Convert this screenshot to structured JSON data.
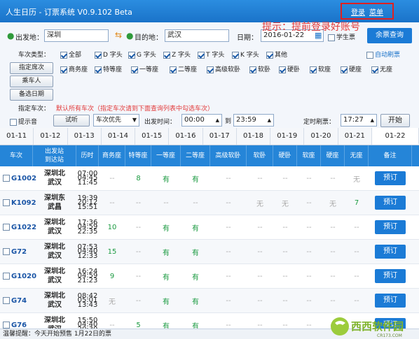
{
  "window": {
    "title": "人生日历 - 订票系统 V0.9.102 Beta",
    "login": "登录",
    "menu": "菜单"
  },
  "hint": "提示：提前登录好账号",
  "search": {
    "from_label": "出发地：",
    "from": "深圳",
    "to_label": "目的地：",
    "to": "武汉",
    "date_label": "日期：",
    "date": "2016-01-22",
    "student": "学生票",
    "query": "余票查询"
  },
  "train_types": {
    "label": "车次类型：",
    "items": [
      "全部",
      "D 字头",
      "G 字头",
      "Z 字头",
      "T 字头",
      "K 字头",
      "其他"
    ],
    "auto_refresh": "自动刷票"
  },
  "seats": {
    "button": "指定席次",
    "items": [
      "商务座",
      "特等座",
      "一等座",
      "二等座",
      "高级软卧",
      "软卧",
      "硬卧",
      "软座",
      "硬座",
      "无座"
    ]
  },
  "passenger_btn": "乘车人",
  "backup_date_btn": "备选日期",
  "specify": {
    "label": "指定车次：",
    "text": "默认所有车次（指定车次请到下面查询列表中勾选车次）"
  },
  "options": {
    "alert": "提示音",
    "test": "试听",
    "priority": "车次优先",
    "depart_label": "出发时间：",
    "time_from": "00:00",
    "to_label": "到",
    "time_to": "23:59",
    "refresh_label": "定时刷票：",
    "refresh_time": "17:27",
    "start": "开始"
  },
  "dates": [
    "01-11",
    "01-12",
    "01-13",
    "01-14",
    "01-15",
    "01-16",
    "01-17",
    "01-18",
    "01-19",
    "01-20",
    "01-21",
    "01-22"
  ],
  "active_date": "01-22",
  "columns": [
    "车次",
    "出发站\n到达站",
    "历时",
    "商务座",
    "特等座",
    "一等座",
    "二等座",
    "高级软卧",
    "软卧",
    "硬卧",
    "软座",
    "硬座",
    "无座",
    "备注"
  ],
  "trains": [
    {
      "id": "G1002",
      "from": "深圳北",
      "to": "武汉",
      "dep": "07:00",
      "arr": "11:45",
      "dur": "04:45",
      "seats": [
        "--",
        "8",
        "有",
        "有",
        "--",
        "--",
        "--",
        "--",
        "--",
        "无"
      ],
      "action": "预订"
    },
    {
      "id": "K1092",
      "from": "深圳东",
      "to": "武昌",
      "dep": "19:39",
      "arr": "15:51",
      "dur": "20:12",
      "seats": [
        "--",
        "--",
        "--",
        "--",
        "--",
        "无",
        "无",
        "--",
        "无",
        "7"
      ],
      "action": "预订"
    },
    {
      "id": "G1022",
      "from": "深圳北",
      "to": "武汉",
      "dep": "17:36",
      "arr": "22:35",
      "dur": "04:59",
      "seats": [
        "10",
        "--",
        "有",
        "有",
        "--",
        "--",
        "--",
        "--",
        "--",
        "--"
      ],
      "action": "预订"
    },
    {
      "id": "G72",
      "from": "深圳北",
      "to": "武汉",
      "dep": "07:53",
      "arr": "12:33",
      "dur": "04:40",
      "seats": [
        "15",
        "--",
        "有",
        "有",
        "--",
        "--",
        "--",
        "--",
        "--",
        "--"
      ],
      "action": "预订"
    },
    {
      "id": "G1020",
      "from": "深圳北",
      "to": "武汉",
      "dep": "16:24",
      "arr": "21:23",
      "dur": "04:59",
      "seats": [
        "9",
        "--",
        "有",
        "有",
        "--",
        "--",
        "--",
        "--",
        "--",
        "--"
      ],
      "action": "预订"
    },
    {
      "id": "G74",
      "from": "深圳北",
      "to": "武汉",
      "dep": "08:42",
      "arr": "13:43",
      "dur": "05:01",
      "seats": [
        "无",
        "--",
        "有",
        "有",
        "--",
        "--",
        "--",
        "--",
        "--",
        "--"
      ],
      "action": "预订"
    },
    {
      "id": "G76",
      "from": "深圳北",
      "to": "武汉",
      "dep": "15:50",
      "arr": "20:30",
      "dur": "04:40",
      "seats": [
        "--",
        "5",
        "有",
        "有",
        "--",
        "--",
        "--",
        "--",
        "--",
        "--"
      ],
      "action": "预订"
    }
  ],
  "status": "温馨提醒：今天开始预售 1月22日的票",
  "watermark": {
    "text": "西西软件园",
    "sub": "CR173.COM"
  }
}
